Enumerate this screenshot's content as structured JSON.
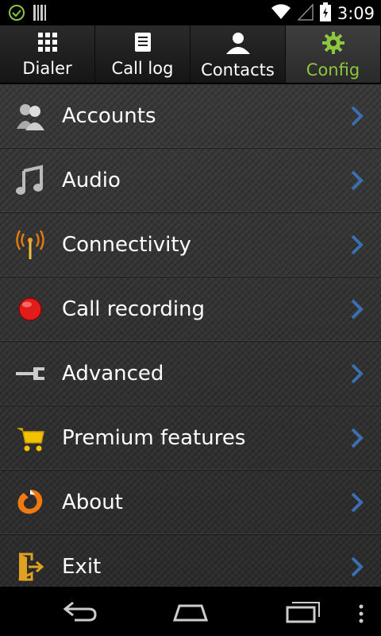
{
  "status_bar": {
    "time": "3:09",
    "icons": [
      "check-circle-icon",
      "barcode-icon",
      "wifi-icon",
      "signal-icon",
      "battery-icon"
    ]
  },
  "tabs": [
    {
      "label": "Dialer",
      "icon": "dialpad-icon",
      "active": false
    },
    {
      "label": "Call log",
      "icon": "call-log-icon",
      "active": false
    },
    {
      "label": "Contacts",
      "icon": "contact-icon",
      "active": false
    },
    {
      "label": "Config",
      "icon": "gear-icon",
      "active": true
    }
  ],
  "menu": [
    {
      "label": "Accounts",
      "icon": "accounts-icon"
    },
    {
      "label": "Audio",
      "icon": "music-note-icon"
    },
    {
      "label": "Connectivity",
      "icon": "antenna-icon"
    },
    {
      "label": "Call recording",
      "icon": "record-icon"
    },
    {
      "label": "Advanced",
      "icon": "wrench-icon"
    },
    {
      "label": "Premium features",
      "icon": "cart-icon"
    },
    {
      "label": "About",
      "icon": "about-icon"
    },
    {
      "label": "Exit",
      "icon": "exit-icon"
    }
  ],
  "navbar": {
    "icons": [
      "back-icon",
      "home-icon",
      "recents-icon",
      "overflow-menu-icon"
    ]
  },
  "colors": {
    "accent": "#8cc63f",
    "chevron": "#3a6fb0",
    "record": "#e21b1b"
  }
}
